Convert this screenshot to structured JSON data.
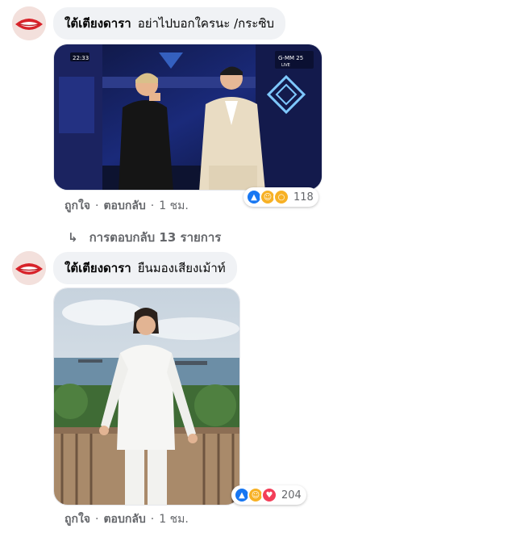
{
  "comments": [
    {
      "author": "ใต้เตียงดารา",
      "text": "อย่าไปบอกใครนะ /กระซิบ",
      "image_labels": {
        "time": "22:33",
        "channel": "G-MM 25",
        "live": "LIVE"
      },
      "reaction_count": "118",
      "reaction_icons": [
        "like-icon",
        "haha-icon",
        "wow-icon"
      ],
      "like": "ถูกใจ",
      "reply": "ตอบกลับ",
      "time": "1 ชม.",
      "replies_link": "การตอบกลับ 13 รายการ"
    },
    {
      "author": "ใต้เตียงดารา",
      "text": "ยืนมองเสียงเม้าท์",
      "reaction_count": "204",
      "reaction_icons": [
        "like-icon",
        "haha-icon",
        "love-icon"
      ],
      "like": "ถูกใจ",
      "reply": "ตอบกลับ",
      "time": "1 ชม."
    }
  ],
  "separator": "·",
  "colors": {
    "like": "#1877f2",
    "haha": "#f7b125",
    "love": "#f33e58",
    "secondary_text": "#65676b",
    "bubble": "#f0f2f5"
  }
}
